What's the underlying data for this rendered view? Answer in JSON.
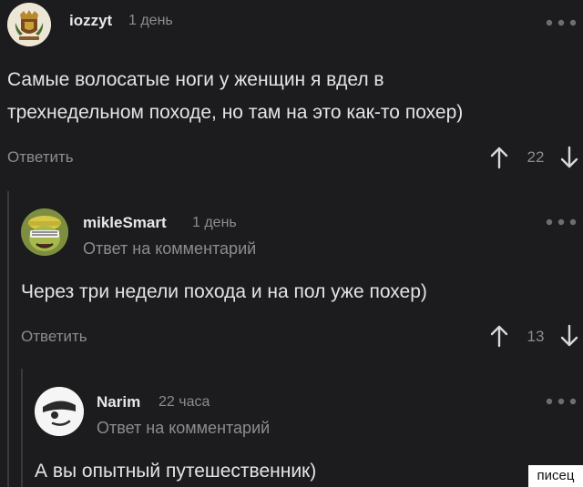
{
  "comments": [
    {
      "username": "iozzyt",
      "time": "1 день",
      "text_line1": "Самые волосатые ноги у женщин я вдел в",
      "text_line2": "трехнедельном походе, но там на это как-то похер)",
      "reply_label": "Ответить",
      "score": "22",
      "avatar_icon": "emblem-avatar"
    },
    {
      "username": "mikleSmart",
      "time": "1 день",
      "reply_to": "Ответ на комментарий",
      "text": "Через три недели похода и на пол уже похер)",
      "reply_label": "Ответить",
      "score": "13",
      "avatar_icon": "cartoon-avatar"
    },
    {
      "username": "Narim",
      "time": "22 часа",
      "reply_to": "Ответ на комментарий",
      "text": "А вы опытный путешественник)",
      "avatar_icon": "default-avatar"
    }
  ],
  "watermark": "писец",
  "colors": {
    "background": "#1c1c1e",
    "text": "#e4e4e4",
    "muted": "#8c8c8c",
    "thread_line": "#3a3a3c"
  }
}
